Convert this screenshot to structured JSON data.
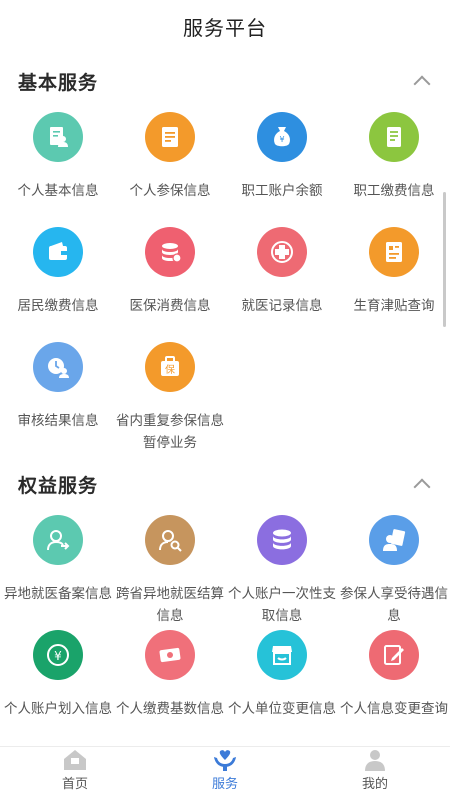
{
  "header": {
    "title": "服务平台"
  },
  "sections": [
    {
      "title": "基本服务",
      "items": [
        {
          "label": "个人基本信息",
          "icon": "person-card-icon",
          "color": "#5cc9b0"
        },
        {
          "label": "个人参保信息",
          "icon": "document-icon",
          "color": "#f39a2b"
        },
        {
          "label": "职工账户余额",
          "icon": "money-bag-icon",
          "color": "#2e8fe0"
        },
        {
          "label": "职工缴费信息",
          "icon": "invoice-icon",
          "color": "#8cc63f"
        },
        {
          "label": "居民缴费信息",
          "icon": "wallet-icon",
          "color": "#26b6ef"
        },
        {
          "label": "医保消费信息",
          "icon": "coins-stack-icon",
          "color": "#ef6070"
        },
        {
          "label": "就医记录信息",
          "icon": "medical-cross-icon",
          "color": "#ee6a73"
        },
        {
          "label": "生育津贴查询",
          "icon": "form-icon",
          "color": "#f39a2b"
        },
        {
          "label": "审核结果信息",
          "icon": "clock-person-icon",
          "color": "#6aa6ea"
        },
        {
          "label": "省内重复参保信息暂停业务",
          "icon": "insurance-bag-icon",
          "color": "#f39a2b"
        }
      ]
    },
    {
      "title": "权益服务",
      "items": [
        {
          "label": "异地就医备案信息",
          "icon": "person-transfer-icon",
          "color": "#5cc9b0"
        },
        {
          "label": "跨省异地就医结算信息",
          "icon": "person-search-icon",
          "color": "#c6955e"
        },
        {
          "label": "个人账户一次性支取信息",
          "icon": "database-icon",
          "color": "#8b6ee0"
        },
        {
          "label": "参保人享受待遇信息",
          "icon": "person-document-icon",
          "color": "#5a9ee8"
        },
        {
          "label": "个人账户划入信息",
          "icon": "yuan-coin-icon",
          "color": "#1aa36a"
        },
        {
          "label": "个人缴费基数信息",
          "icon": "ticket-icon",
          "color": "#f0707a"
        },
        {
          "label": "个人单位变更信息",
          "icon": "store-icon",
          "color": "#26c2d8"
        },
        {
          "label": "个人信息变更查询",
          "icon": "edit-note-icon",
          "color": "#ee6a73"
        }
      ]
    }
  ],
  "tabbar": {
    "items": [
      {
        "label": "首页",
        "icon": "home-icon"
      },
      {
        "label": "服务",
        "icon": "heart-hands-icon"
      },
      {
        "label": "我的",
        "icon": "user-icon"
      }
    ],
    "active_color": "#3c7bd8",
    "inactive_color": "#c8c8c8"
  }
}
